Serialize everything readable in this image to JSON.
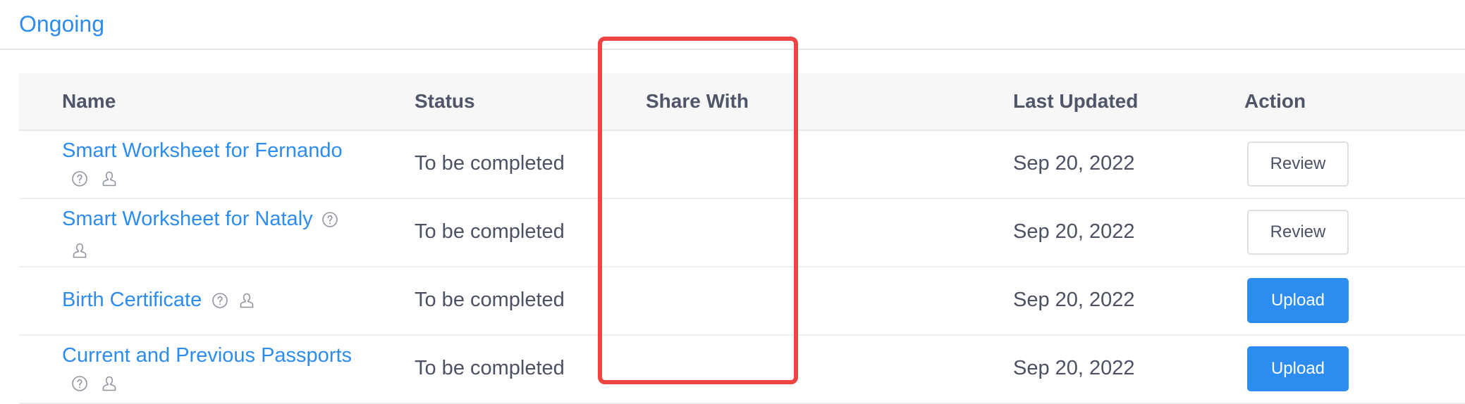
{
  "tab": {
    "label": "Ongoing"
  },
  "table": {
    "headers": {
      "name": "Name",
      "status": "Status",
      "share_with": "Share With",
      "last_updated": "Last Updated",
      "action": "Action"
    },
    "rows": [
      {
        "name": "Smart Worksheet for Fernando",
        "status": "To be completed",
        "share_with": "",
        "last_updated": "Sep 20, 2022",
        "action": "Review"
      },
      {
        "name": "Smart Worksheet for Nataly",
        "status": "To be completed",
        "share_with": "",
        "last_updated": "Sep 20, 2022",
        "action": "Review"
      },
      {
        "name": "Birth Certificate",
        "status": "To be completed",
        "share_with": "",
        "last_updated": "Sep 20, 2022",
        "action": "Upload"
      },
      {
        "name": "Current and Previous Passports",
        "status": "To be completed",
        "share_with": "",
        "last_updated": "Sep 20, 2022",
        "action": "Upload"
      }
    ]
  },
  "icons": {
    "help": "question-circle-icon",
    "person": "user-icon"
  },
  "colors": {
    "link": "#2d8cf0",
    "primary_button": "#2d8cf0",
    "highlight_box": "#ef4444",
    "header_bg": "#f7f7f8"
  }
}
